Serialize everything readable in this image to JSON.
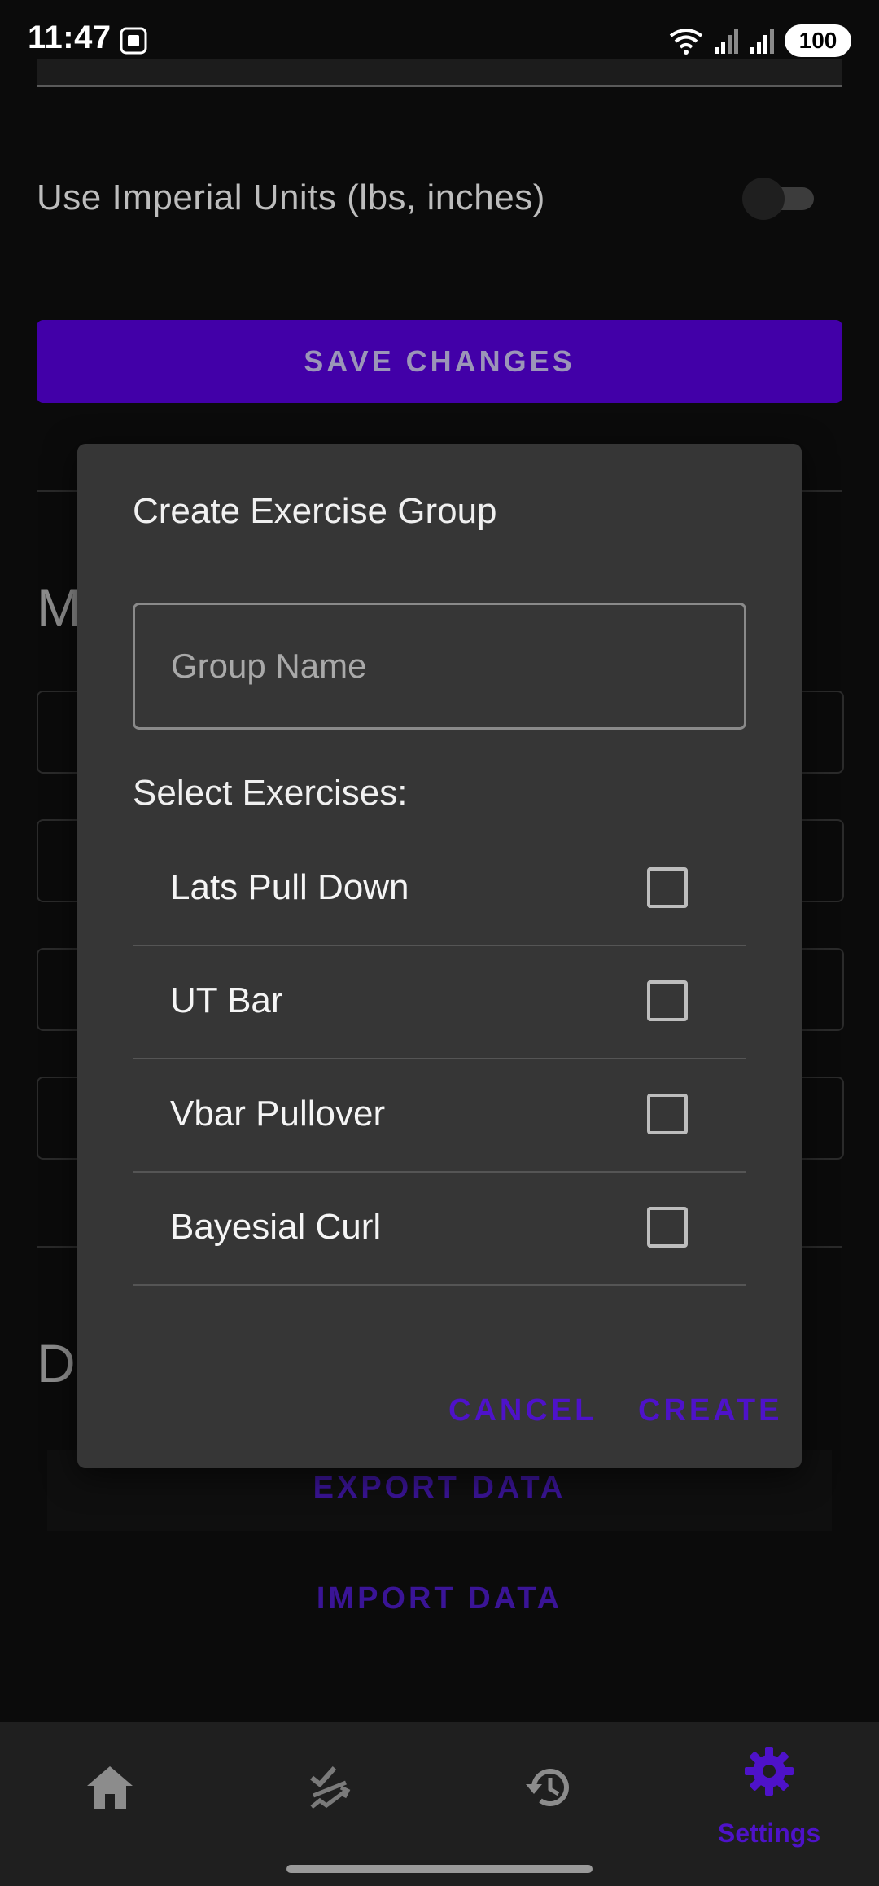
{
  "status_bar": {
    "time": "11:47",
    "battery": "100",
    "icons": [
      "screenshot-icon",
      "wifi-icon",
      "signal-icon",
      "signal-icon"
    ]
  },
  "settings": {
    "imperial_label": "Use Imperial Units (lbs, inches)",
    "imperial_enabled": false,
    "save_label": "SAVE CHANGES",
    "section_partial_1": "M",
    "section_partial_2": "D",
    "export_label": "EXPORT DATA",
    "import_label": "IMPORT DATA"
  },
  "dialog": {
    "title": "Create Exercise Group",
    "group_name_placeholder": "Group Name",
    "group_name_value": "",
    "select_label": "Select Exercises:",
    "exercises": [
      {
        "name": "Lats Pull Down",
        "checked": false
      },
      {
        "name": "UT Bar",
        "checked": false
      },
      {
        "name": "Vbar Pullover",
        "checked": false
      },
      {
        "name": "Bayesial Curl",
        "checked": false
      }
    ],
    "cancel_label": "CANCEL",
    "create_label": "CREATE"
  },
  "bottom_nav": {
    "items": [
      {
        "icon": "home-icon",
        "label": ""
      },
      {
        "icon": "shuffle-check-icon",
        "label": ""
      },
      {
        "icon": "history-icon",
        "label": ""
      },
      {
        "icon": "gear-icon",
        "label": "Settings",
        "active": true
      }
    ]
  },
  "colors": {
    "accent": "#4e12c9",
    "save_button": "#4200a8",
    "dialog_bg": "#363636",
    "page_bg": "#0b0b0b",
    "nav_bg": "#1f1f1f"
  }
}
